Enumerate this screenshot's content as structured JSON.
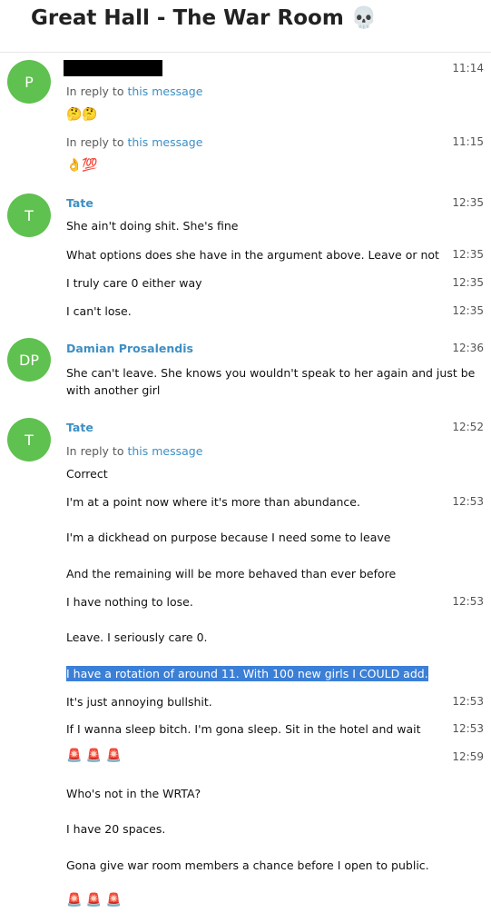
{
  "chat": {
    "title": "Great Hall - The War Room",
    "title_emoji": "💀"
  },
  "reply": {
    "prefix": "In reply to",
    "link": "this message"
  },
  "messages": {
    "m1": {
      "avatar": "P",
      "time_a": "11:14",
      "reactions_a": "🤔🤔",
      "time_b": "11:15",
      "reactions_b": "👌💯"
    },
    "m2": {
      "avatar": "T",
      "sender": "Tate",
      "time": "12:35",
      "lines": [
        "She ain't doing shit. She's fine",
        "What options does she have in the argument above. Leave or not",
        "I truly care 0 either way",
        "I can't lose."
      ],
      "times": [
        "12:35",
        "12:35",
        "12:35"
      ]
    },
    "m3": {
      "avatar": "DP",
      "sender": "Damian Prosalendis",
      "time": "12:36",
      "text": "She can't leave. She knows you wouldn't speak to her again and just be with another girl"
    },
    "m4": {
      "avatar": "T",
      "sender": "Tate",
      "time": "12:52",
      "lines": [
        "Correct",
        "I'm at a point now where it's more than abundance.",
        "I'm a dickhead on purpose because I need some to leave",
        "And the remaining will be more behaved than ever before",
        "I have nothing to lose.",
        "Leave. I seriously care 0.",
        "I have a rotation of around 11. With 100 new girls I COULD add.",
        "It's just annoying bullshit.",
        "If I wanna sleep bitch. I'm gona sleep. Sit in the hotel and wait",
        "Who's not in the WRTA?",
        "I have 20 spaces.",
        "Gona give war room members a chance before I open to public."
      ],
      "times": [
        "12:53",
        "12:53",
        "12:53",
        "12:53",
        "12:59"
      ],
      "sirens": "🚨 🚨 🚨"
    }
  }
}
